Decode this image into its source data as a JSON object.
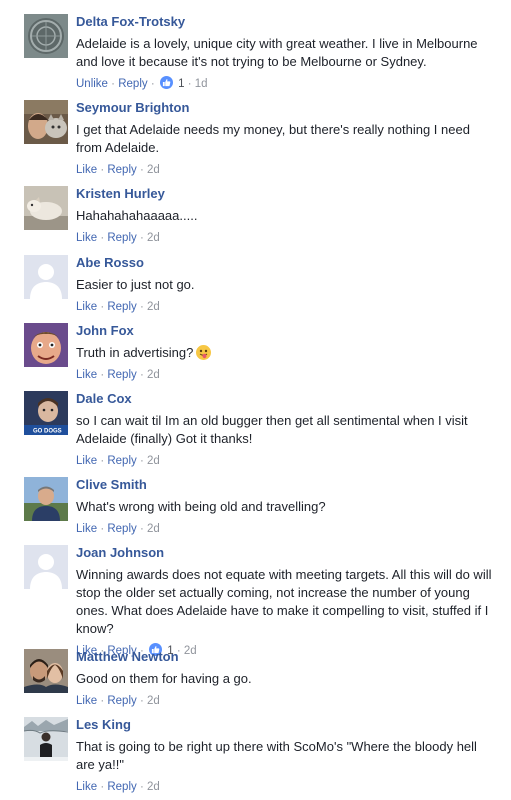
{
  "comments": [
    {
      "author": "Delta Fox-Trotsky",
      "text": "Adelaide is a lovely, unique city with great weather. I live in Melbourne and love it because it's not trying to be Melbourne or Sydney.",
      "like_label": "Unlike",
      "reply_label": "Reply",
      "dot": "·",
      "like_count": "1",
      "time": "1d",
      "avatar_icon": "manhole-cover-avatar"
    },
    {
      "author": "Seymour Brighton",
      "text": "I get that Adelaide needs my money, but there's really nothing I need from Adelaide.",
      "like_label": "Like",
      "reply_label": "Reply",
      "dot": "·",
      "time": "2d",
      "avatar_icon": "man-with-cat-avatar"
    },
    {
      "author": "Kristen Hurley",
      "text": "Hahahahahaaaaa.....",
      "like_label": "Like",
      "reply_label": "Reply",
      "dot": "·",
      "time": "2d",
      "avatar_icon": "dog-avatar"
    },
    {
      "author": "Abe Rosso",
      "text": "Easier to just not go.",
      "like_label": "Like",
      "reply_label": "Reply",
      "dot": "·",
      "time": "2d",
      "avatar_icon": "default-person-avatar"
    },
    {
      "author": "John Fox",
      "text": "Truth in advertising?",
      "emoji": "tongue-out-emoji",
      "like_label": "Like",
      "reply_label": "Reply",
      "dot": "·",
      "time": "2d",
      "avatar_icon": "caricature-avatar"
    },
    {
      "author": "Dale Cox",
      "text": "so I can wait til Im an old bugger then get all sentimental when I visit Adelaide (finally) Got it thanks!",
      "like_label": "Like",
      "reply_label": "Reply",
      "dot": "·",
      "time": "2d",
      "avatar_icon": "child-photo-avatar",
      "avatar_caption": "GO DOGS"
    },
    {
      "author": "Clive Smith",
      "text": "What's wrong with being old and travelling?",
      "like_label": "Like",
      "reply_label": "Reply",
      "dot": "·",
      "time": "2d",
      "avatar_icon": "man-outdoors-avatar"
    },
    {
      "author": "Joan Johnson",
      "text": "Winning awards does not equate with meeting targets. All this will do will stop the older set actually coming, not increase the number of young ones. What does Adelaide have to make it compelling to visit, stuffed if I know?",
      "like_label": "Like",
      "reply_label": "Reply",
      "dot": "·",
      "like_count": "1",
      "time": "2d",
      "avatar_icon": "default-person-avatar"
    },
    {
      "author": "Matthew Newton",
      "text": "Good on them for having a go.",
      "like_label": "Like",
      "reply_label": "Reply",
      "dot": "·",
      "time": "2d",
      "avatar_icon": "couple-selfie-avatar"
    },
    {
      "author": "Les King",
      "text": "That is going to be right up there with ScoMo's \"Where the bloody hell are ya!!\"",
      "like_label": "Like",
      "reply_label": "Reply",
      "dot": "·",
      "time": "2d",
      "avatar_icon": "man-in-snow-avatar"
    }
  ],
  "colors": {
    "author": "#365899",
    "action_link": "#4267b2",
    "meta": "#90949c",
    "text": "#1d2129",
    "like_badge": "#5890ff"
  }
}
